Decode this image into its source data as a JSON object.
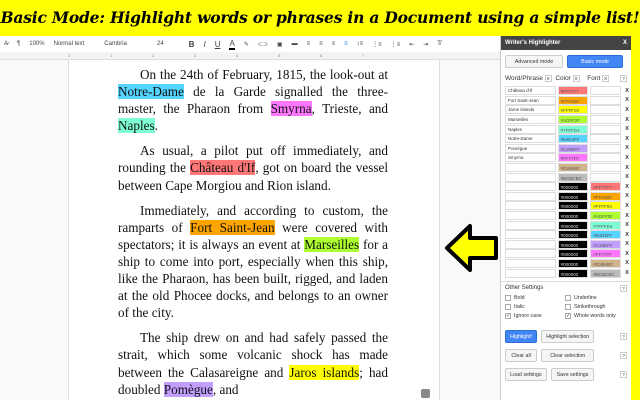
{
  "banner": {
    "title": "Basic Mode: Highlight words or phrases in a Document using a simple list!"
  },
  "toolbar": {
    "zoom": "100%",
    "style": "Normal text",
    "font": "Cambria",
    "size": "24",
    "bold": "B",
    "italic": "I",
    "underline": "U",
    "text_color": "A"
  },
  "ruler": {
    "ticks": [
      "1",
      "1",
      "2",
      "3",
      "4",
      "5",
      "6",
      "7"
    ]
  },
  "doc": {
    "paragraphs": [
      [
        {
          "t": "On the 24th of February, 1815, the look-out at "
        },
        {
          "t": "Notre-Dame",
          "c": "#54D4FF"
        },
        {
          "t": " de la Garde signalled the three-master, the Pharaon from "
        },
        {
          "t": "Smyrna",
          "c": "#FF77FF"
        },
        {
          "t": ", Trieste, and "
        },
        {
          "t": "Naples",
          "c": "#7FFFD4"
        },
        {
          "t": "."
        }
      ],
      [
        {
          "t": "As usual, a pilot put off immediately, and rounding the "
        },
        {
          "t": "Château d'If",
          "c": "#FF7777"
        },
        {
          "t": ", got  on board the vessel between Cape Morgiou and Rion island."
        }
      ],
      [
        {
          "t": "Immediately, and according to custom, the ramparts of "
        },
        {
          "t": "Fort Saint-Jean",
          "c": "#FFA500"
        },
        {
          "t": " were covered with spectators; it is always an event at "
        },
        {
          "t": "Marseilles",
          "c": "#ADFF2F"
        },
        {
          "t": " for a ship to come into port, especially when this ship, like the Pharaon, has been built, rigged, and laden at the old Phocee docks, and belongs to an owner of the city."
        }
      ],
      [
        {
          "t": "The ship drew on and had safely passed the strait, which some volcanic shock has made between the Calasareigne and "
        },
        {
          "t": "Jaros islands",
          "c": "#FFFF00"
        },
        {
          "t": "; had doubled "
        },
        {
          "t": "Pomègue",
          "c": "#C29EFF"
        },
        {
          "t": ", and"
        }
      ]
    ]
  },
  "sidebar": {
    "title": "Writer's Highlighter",
    "close": "X",
    "advanced_mode": "Advanced mode",
    "basic_mode": "Basic mode",
    "col_word": "Word/Phrase",
    "col_color": "Color",
    "col_font": "Font",
    "x": "X",
    "help": "?",
    "rows": [
      {
        "word": "Château d'If",
        "color": "#FF7777",
        "font": ""
      },
      {
        "word": "Fort Saint-Jean",
        "color": "#FFA500",
        "font": ""
      },
      {
        "word": "Jaros islands",
        "color": "#FFFF00",
        "font": ""
      },
      {
        "word": "Marseilles",
        "color": "#ADFF2F",
        "font": ""
      },
      {
        "word": "Naples",
        "color": "#7FFFD4",
        "font": ""
      },
      {
        "word": "Notre-Dame",
        "color": "#54D4FF",
        "font": ""
      },
      {
        "word": "Pomègue",
        "color": "#C29EFF",
        "font": ""
      },
      {
        "word": "Smyrna",
        "color": "#FF77FF",
        "font": ""
      },
      {
        "word": "",
        "color": "#D2B48C",
        "font": ""
      },
      {
        "word": "",
        "color": "#BCBCBC",
        "font": ""
      },
      {
        "word": "",
        "color": "#000000",
        "font": "#FF7777"
      },
      {
        "word": "",
        "color": "#000000",
        "font": "#FFA500"
      },
      {
        "word": "",
        "color": "#000000",
        "font": "#FFFF00"
      },
      {
        "word": "",
        "color": "#000000",
        "font": "#ADFF2F"
      },
      {
        "word": "",
        "color": "#000000",
        "font": "#7FFFD4"
      },
      {
        "word": "",
        "color": "#000000",
        "font": "#54D4FF"
      },
      {
        "word": "",
        "color": "#000000",
        "font": "#C29EFF"
      },
      {
        "word": "",
        "color": "#000000",
        "font": "#FF77FF"
      },
      {
        "word": "",
        "color": "#000000",
        "font": "#D2B48C"
      },
      {
        "word": "",
        "color": "#000000",
        "font": "#BCBCBC"
      }
    ],
    "other_settings": "Other Settings",
    "bold": "Bold",
    "underline": "Underline",
    "italic": "Italic",
    "strikethrough": "Strikethrough",
    "ignore_case": "Ignore case",
    "whole_words": "Whole words only",
    "check": "✓",
    "highlight": "Highlight!",
    "highlight_selection": "Highlight selection",
    "clear_all": "Clear all",
    "clear_selection": "Clear selection",
    "load_settings": "Load settings",
    "save_settings": "Save settings"
  }
}
